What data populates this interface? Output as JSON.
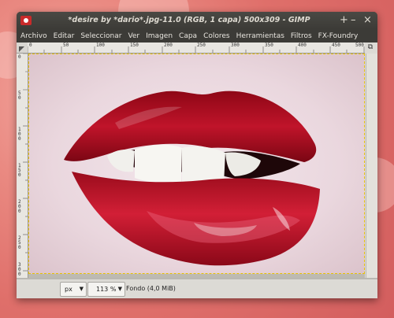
{
  "window": {
    "title": "*desire by *dario*.jpg-11.0 (RGB, 1 capa) 500x309 - GIMP",
    "buttons": [
      "+",
      "–",
      "×"
    ]
  },
  "menubar": [
    {
      "label": "Archivo"
    },
    {
      "label": "Editar"
    },
    {
      "label": "Seleccionar"
    },
    {
      "label": "Ver"
    },
    {
      "label": "Imagen"
    },
    {
      "label": "Capa"
    },
    {
      "label": "Colores"
    },
    {
      "label": "Herramientas"
    },
    {
      "label": "Filtros"
    },
    {
      "label": "FX-Foundry"
    }
  ],
  "ruler": {
    "h_labels": [
      "0",
      "50",
      "100",
      "150",
      "200",
      "250",
      "300",
      "350",
      "400",
      "450",
      "500"
    ],
    "v_labels": [
      "0",
      "50",
      "100",
      "150",
      "200",
      "250",
      "300"
    ]
  },
  "statusbar": {
    "unit": "px",
    "zoom": "113 %",
    "layer_info": "Fondo (4,0 MiB)"
  },
  "colors": {
    "lip_red": "#b0101f",
    "selection_marquee": "#e6c200"
  }
}
